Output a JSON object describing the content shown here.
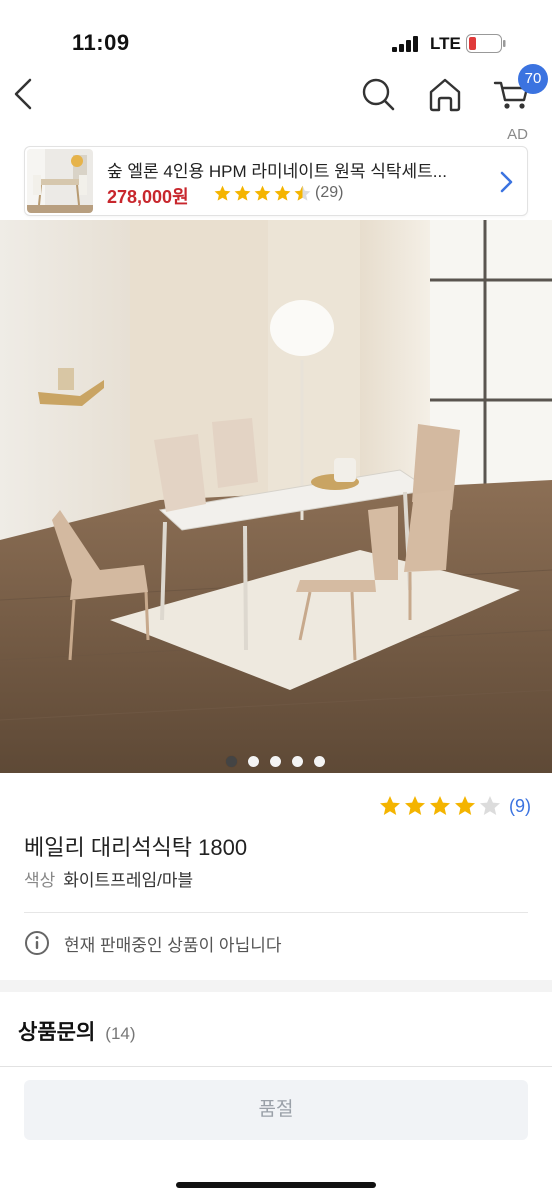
{
  "status": {
    "time": "11:09",
    "network": "LTE"
  },
  "nav": {
    "cart_count": "70"
  },
  "ad": {
    "label": "AD",
    "title": "숲 엘론 4인용 HPM 라미네이트 원목 식탁세트...",
    "price": "278,000원",
    "rating": 4.5,
    "review_count": "(29)"
  },
  "gallery": {
    "total": 5,
    "active_index": 0
  },
  "product": {
    "rating": 4,
    "review_count": "(9)",
    "title": "베일리 대리석식탁 1800",
    "option_label": "색상",
    "option_value": "화이트프레임/마블",
    "notice": "현재 판매중인 상품이 아닙니다"
  },
  "qna": {
    "title": "상품문의",
    "count": "(14)"
  },
  "button": {
    "label": "품절"
  },
  "colors": {
    "accent": "#3b73e0",
    "price": "#c8272d",
    "star": "#f4b400",
    "star_empty": "#dcdcdc"
  }
}
